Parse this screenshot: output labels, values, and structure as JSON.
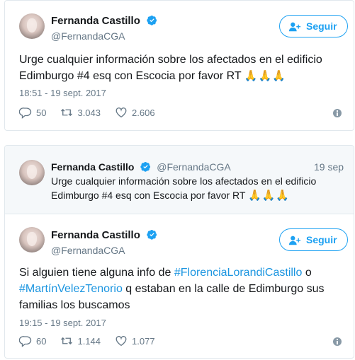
{
  "colors": {
    "accent": "#1da1f2",
    "muted": "#657786",
    "border": "#e1e8ed",
    "quote_bg": "#f5f8fa"
  },
  "tweet1": {
    "name": "Fernanda Castillo",
    "handle": "@FernandaCGA",
    "follow_label": "Seguir",
    "text_line1": "Urge cualquier información sobre los afectados en el edificio",
    "text_line2": "Edimburgo #4 esq con Escocia por favor RT",
    "emoji": "🙏🙏🙏",
    "timestamp": "18:51 - 19 sept. 2017",
    "replies": "50",
    "retweets": "3.043",
    "likes": "2.606"
  },
  "quoted": {
    "name": "Fernanda Castillo",
    "handle": "@FernandaCGA",
    "date": "19 sep",
    "text_line1": "Urge cualquier información sobre los afectados en el edificio",
    "text_line2": "Edimburgo #4 esq con Escocia por favor RT",
    "emoji": "🙏🙏🙏"
  },
  "tweet2": {
    "name": "Fernanda Castillo",
    "handle": "@FernandaCGA",
    "follow_label": "Seguir",
    "text_pre": "Si alguien tiene alguna info de ",
    "hashtag1": "#FlorenciaLorandiCastillo",
    "text_mid": " o",
    "hashtag2": "#MartínVelezTenorio",
    "text_line2_rest": " q estaban en la calle de Edimburgo sus",
    "text_line3": "familias los buscamos",
    "timestamp": "19:15 - 19 sept. 2017",
    "replies": "60",
    "retweets": "1.144",
    "likes": "1.077"
  },
  "icons": [
    "verified-badge-icon",
    "follow-person-icon",
    "reply-icon",
    "retweet-icon",
    "like-icon",
    "info-icon"
  ]
}
